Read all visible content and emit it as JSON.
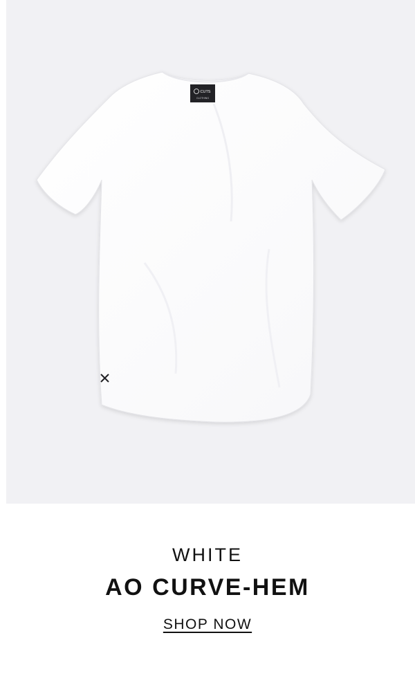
{
  "product": {
    "color": "WHITE",
    "name": "AO CURVE-HEM",
    "cta_label": "SHOP NOW",
    "image": {
      "icon": "tshirt-image",
      "background_color": "#f1f1f4",
      "shirt_color": "#ffffff",
      "neck_label_text": "CUTS",
      "neck_label_subtext": "CLOTHING"
    }
  },
  "colors": {
    "text": "#111111",
    "page_background": "#ffffff"
  }
}
